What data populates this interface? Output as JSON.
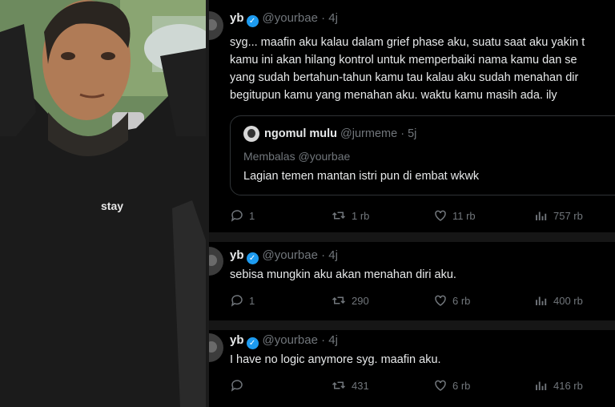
{
  "tweets": [
    {
      "author": {
        "name": "yb",
        "handle": "@yourbae",
        "time": "4j",
        "verified_icon": "verified-badge-icon"
      },
      "lines": [
        "syg... maafin aku kalau dalam grief phase aku, suatu saat aku yakin t",
        "kamu ini akan hilang kontrol untuk memperbaiki nama kamu dan se",
        "yang sudah bertahun-tahun kamu tau kalau aku sudah menahan dir",
        "begitupun kamu yang menahan aku. waktu kamu masih ada. ily"
      ],
      "quote": {
        "name": "ngomul mulu",
        "handle": "@jurmeme",
        "time": "5j",
        "reply_prefix": "Membalas",
        "reply_to": "@yourbae",
        "text": "Lagian temen mantan istri pun di embat wkwk"
      },
      "stats": {
        "replies": "1",
        "retweets": "1 rb",
        "likes": "11 rb",
        "views": "757 rb"
      }
    },
    {
      "author": {
        "name": "yb",
        "handle": "@yourbae",
        "time": "4j",
        "verified_icon": "verified-badge-icon"
      },
      "lines": [
        "sebisa mungkin aku akan menahan diri aku."
      ],
      "stats": {
        "replies": "1",
        "retweets": "290",
        "likes": "6 rb",
        "views": "400 rb"
      }
    },
    {
      "author": {
        "name": "yb",
        "handle": "@yourbae",
        "time": "4j",
        "verified_icon": "verified-badge-icon"
      },
      "lines": [
        "I have no logic anymore syg. maafin aku."
      ],
      "stats": {
        "replies": "",
        "retweets": "431",
        "likes": "6 rb",
        "views": "416 rb"
      }
    }
  ],
  "photo": {
    "shirt_text": "stay",
    "bg_color": "#5f7a55",
    "shirt_color": "#1a1a1a"
  },
  "colors": {
    "text": "#e7e9ea",
    "muted": "#71767b",
    "verified": "#1d9bf0",
    "background": "#000000"
  },
  "icons": [
    "reply-icon",
    "retweet-icon",
    "like-icon",
    "views-icon"
  ]
}
